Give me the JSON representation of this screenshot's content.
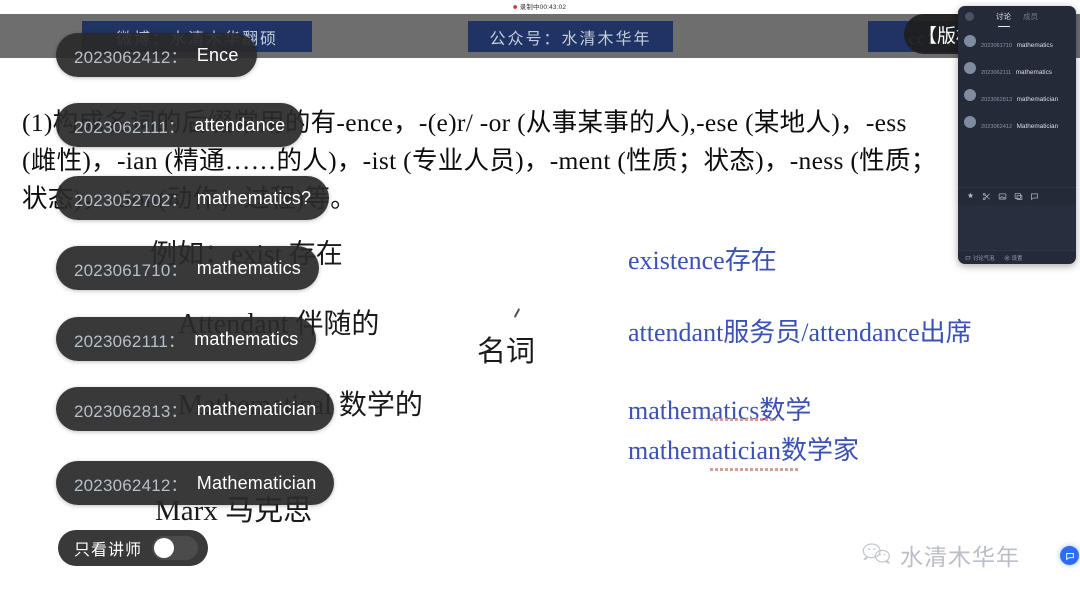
{
  "recording": {
    "status_text": "录制中00:43:02",
    "dot_color": "#e03030"
  },
  "banners": {
    "left": "微博：水清木华翻硕",
    "middle": "公众号：水清木华年",
    "right": "cc：水清木华年"
  },
  "slide": {
    "body_text": "(1)构成名词的后缀常用的有-ence，-(e)r/ -or (从事某事的人),-ese (某地人)，-ess (雌性)，-ian (精通……的人)，-ist (专业人员)，-ment (性质；状态)，-ness (性质；状态)，-tion(动作；过程)等。",
    "ink_notes": {
      "exist": "例如：exist 存在",
      "attendant": "Attendant 伴随的",
      "mathematical": "Mathematical 数学的",
      "marx": "Marx 马克思",
      "noun_label": "名词"
    },
    "vocab_blue": [
      "existence存在",
      "attendant服务员/attendance出席",
      "mathematics数学",
      "mathematician数学家"
    ],
    "blue_color": "#3b52b4"
  },
  "subtitles": [
    {
      "uid": "2023062412",
      "sep": "：",
      "text": "Ence"
    },
    {
      "uid": "2023062111",
      "sep": "：",
      "text": "attendance"
    },
    {
      "uid": "2023052702",
      "sep": "：",
      "text": "mathematics?"
    },
    {
      "uid": "2023061710",
      "sep": "：",
      "text": "mathematics"
    },
    {
      "uid": "2023062111",
      "sep": "：",
      "text": "mathematics"
    },
    {
      "uid": "2023062813",
      "sep": "：",
      "text": "mathematician"
    },
    {
      "uid": "2023062412",
      "sep": "：",
      "text": "Mathematician"
    }
  ],
  "copyright_overlay": {
    "text": "【版权声"
  },
  "lecturer_toggle": {
    "label": "只看讲师",
    "enabled": false
  },
  "chat_panel": {
    "tabs": [
      {
        "label": "讨论",
        "active": true
      },
      {
        "label": "成员",
        "active": false
      }
    ],
    "messages": [
      {
        "name": "2023061710",
        "text": "mathematics"
      },
      {
        "name": "2023062111",
        "text": "mathematics"
      },
      {
        "name": "2023062813",
        "text": "mathematician"
      },
      {
        "name": "2023062412",
        "text": "Mathematician"
      }
    ],
    "tools": [
      "emoji-icon",
      "scissors-icon",
      "image-icon",
      "screenshot-icon",
      "comment-icon"
    ],
    "footer": [
      {
        "icon": "bubble-icon",
        "label": "讨论气泡"
      },
      {
        "icon": "gear-icon",
        "label": "设置"
      }
    ],
    "background_color": "#242a38"
  },
  "watermark": {
    "text": "水清木华年",
    "icon": "wechat-icon",
    "badge_icon": "message-badge-icon",
    "badge_color": "#2d6df6"
  }
}
